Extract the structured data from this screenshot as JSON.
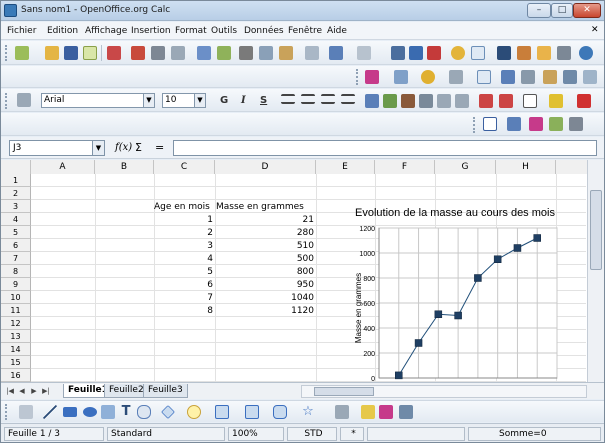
{
  "window": {
    "title": "Sans nom1 - OpenOffice.org Calc",
    "minimize": "–",
    "maximize": "□",
    "close": "✕"
  },
  "menu": {
    "items": [
      "Fichier",
      "Edition",
      "Affichage",
      "Insertion",
      "Format",
      "Outils",
      "Données",
      "Fenêtre",
      "Aide"
    ],
    "close": "✕"
  },
  "format_toolbar": {
    "font_name": "Arial",
    "font_size": "10",
    "bold": "G",
    "italic": "I",
    "underline": "S"
  },
  "formula_bar": {
    "cell_ref": "J3",
    "fx": "f(x)",
    "sum": "Σ",
    "equals": "=",
    "content": ""
  },
  "columns": [
    "A",
    "B",
    "C",
    "D",
    "E",
    "F",
    "G",
    "H"
  ],
  "rows": [
    "1",
    "2",
    "3",
    "4",
    "5",
    "6",
    "7",
    "8",
    "9",
    "10",
    "11",
    "12",
    "13",
    "14",
    "15",
    "16",
    "17"
  ],
  "table": {
    "header_age": "Age en mois",
    "header_mass": "Masse en grammes",
    "ages": [
      "1",
      "2",
      "3",
      "4",
      "5",
      "6",
      "7",
      "8"
    ],
    "masses": [
      "21",
      "280",
      "510",
      "500",
      "800",
      "950",
      "1040",
      "1120"
    ]
  },
  "chart_data": {
    "type": "line",
    "title": "Evolution de la masse au cours des mois",
    "xlabel": "",
    "ylabel": "Masse en grammes",
    "x": [
      1,
      2,
      3,
      4,
      5,
      6,
      7,
      8
    ],
    "series": [
      {
        "values": [
          21,
          280,
          510,
          500,
          800,
          950,
          1040,
          1120
        ]
      }
    ],
    "xlim": [
      0,
      9
    ],
    "ylim": [
      0,
      1200
    ],
    "xticks": [
      "0",
      "1",
      "2",
      "3",
      "4",
      "5",
      "6",
      "7",
      "8",
      "9"
    ],
    "yticks": [
      "0",
      "200",
      "400",
      "600",
      "800",
      "1000",
      "1200"
    ],
    "grid": true,
    "colors": {
      "line": "#1f4e79",
      "marker": "#1f3f63"
    }
  },
  "sheet_tabs": {
    "tabs": [
      "Feuille1",
      "Feuille2",
      "Feuille3"
    ],
    "active": 0
  },
  "status": {
    "sheet": "Feuille 1 / 3",
    "style": "Standard",
    "zoom": "100%",
    "mode": "STD",
    "selection_mode": "*",
    "sum": "Somme=0"
  }
}
